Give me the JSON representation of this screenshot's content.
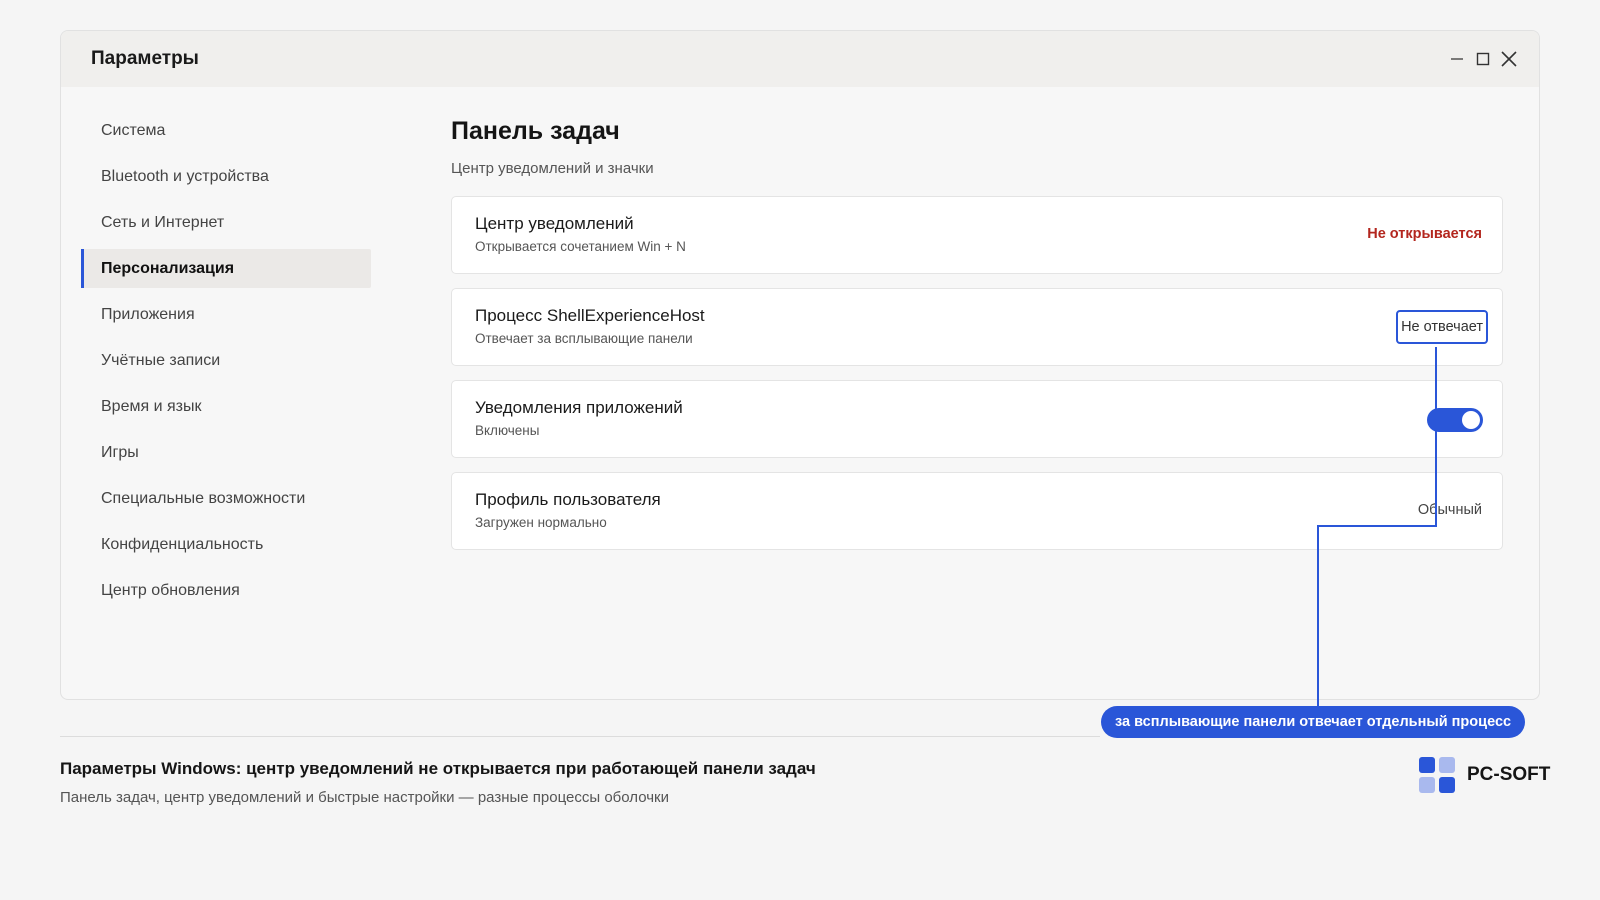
{
  "window": {
    "title": "Параметры",
    "controls": {
      "minimize_icon": "minimize-icon",
      "maximize_icon": "maximize-icon",
      "close_icon": "close-icon"
    }
  },
  "sidebar": {
    "items": [
      {
        "label": "Система",
        "active": false
      },
      {
        "label": "Bluetooth и устройства",
        "active": false
      },
      {
        "label": "Сеть и Интернет",
        "active": false
      },
      {
        "label": "Персонализация",
        "active": true
      },
      {
        "label": "Приложения",
        "active": false
      },
      {
        "label": "Учётные записи",
        "active": false
      },
      {
        "label": "Время и язык",
        "active": false
      },
      {
        "label": "Игры",
        "active": false
      },
      {
        "label": "Специальные возможности",
        "active": false
      },
      {
        "label": "Конфиденциальность",
        "active": false
      },
      {
        "label": "Центр обновления",
        "active": false
      }
    ]
  },
  "main": {
    "title": "Панель задач",
    "subtitle": "Центр уведомлений и значки",
    "cards": [
      {
        "title": "Центр уведомлений",
        "desc": "Открывается сочетанием Win + N",
        "right": "Не открывается"
      },
      {
        "title": "Процесс ShellExperienceHost",
        "desc": "Отвечает за всплывающие панели",
        "right": "Не отвечает"
      },
      {
        "title": "Уведомления приложений",
        "desc": "Включены",
        "toggle_on": true
      },
      {
        "title": "Профиль пользователя",
        "desc": "Загружен нормально",
        "right": "Обычный"
      }
    ]
  },
  "callout": {
    "text": "за всплывающие панели отвечает отдельный процесс"
  },
  "footer": {
    "title": "Параметры Windows: центр уведомлений не открывается при работающей панели задач",
    "subtitle": "Панель задач, центр уведомлений и быстрые настройки — разные процессы оболочки"
  },
  "brand": {
    "name": "PC-SOFT"
  },
  "colors": {
    "accent": "#2a56d8",
    "error": "#b3261e",
    "brand_dark": "#2a56d8",
    "brand_light": "#a9b9ee"
  }
}
